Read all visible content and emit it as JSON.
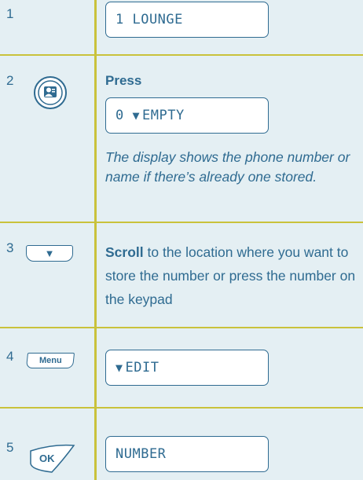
{
  "steps": [
    {
      "number": "1",
      "display": "1 LOUNGE"
    },
    {
      "number": "2",
      "action": "Press",
      "display": "0 ",
      "display_arrow": "▼",
      "display_text": "EMPTY",
      "note": "The display shows the phone number or name if there’s already one stored.",
      "key_icon": "phonebook-key-icon"
    },
    {
      "number": "3",
      "key_arrow": "▼",
      "instruction_bold": "Scroll",
      "instruction_rest": " to the location where you want to store the number or press the number on the keypad"
    },
    {
      "number": "4",
      "key_label": "Menu",
      "display_arrow": "▼",
      "display_text": "EDIT"
    },
    {
      "number": "5",
      "key_label": "OK",
      "display": "NUMBER"
    }
  ],
  "colors": {
    "background": "#e4eff3",
    "text": "#2f6b91",
    "rule": "#c9c23b"
  }
}
